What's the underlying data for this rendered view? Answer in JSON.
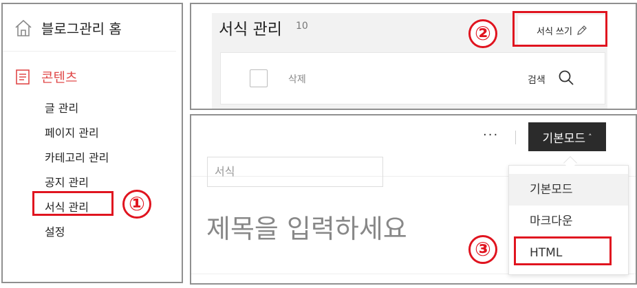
{
  "sidebar": {
    "home_label": "블로그관리 홈",
    "section_label": "콘텐츠",
    "items": [
      {
        "label": "글 관리"
      },
      {
        "label": "페이지 관리"
      },
      {
        "label": "카테고리 관리"
      },
      {
        "label": "공지 관리"
      },
      {
        "label": "서식 관리"
      },
      {
        "label": "설정"
      }
    ]
  },
  "template_manager": {
    "title": "서식 관리",
    "count": "10",
    "write_button": "서식 쓰기",
    "delete_label": "삭제",
    "search_label": "검색"
  },
  "editor": {
    "more_label": "···",
    "mode_button": "기본모드",
    "mode_caret": "˄",
    "category_placeholder": "서식",
    "title_placeholder": "제목을 입력하세요",
    "mode_options": [
      {
        "label": "기본모드",
        "selected": true
      },
      {
        "label": "마크다운",
        "selected": false
      },
      {
        "label": "HTML",
        "selected": false
      }
    ]
  },
  "annotations": {
    "step1": "①",
    "step2": "②",
    "step3": "③",
    "highlight_color": "#e0141f"
  },
  "colors": {
    "accent": "#e04848",
    "dark_button": "#2b2b2b",
    "panel_border": "#8f8f8f"
  }
}
